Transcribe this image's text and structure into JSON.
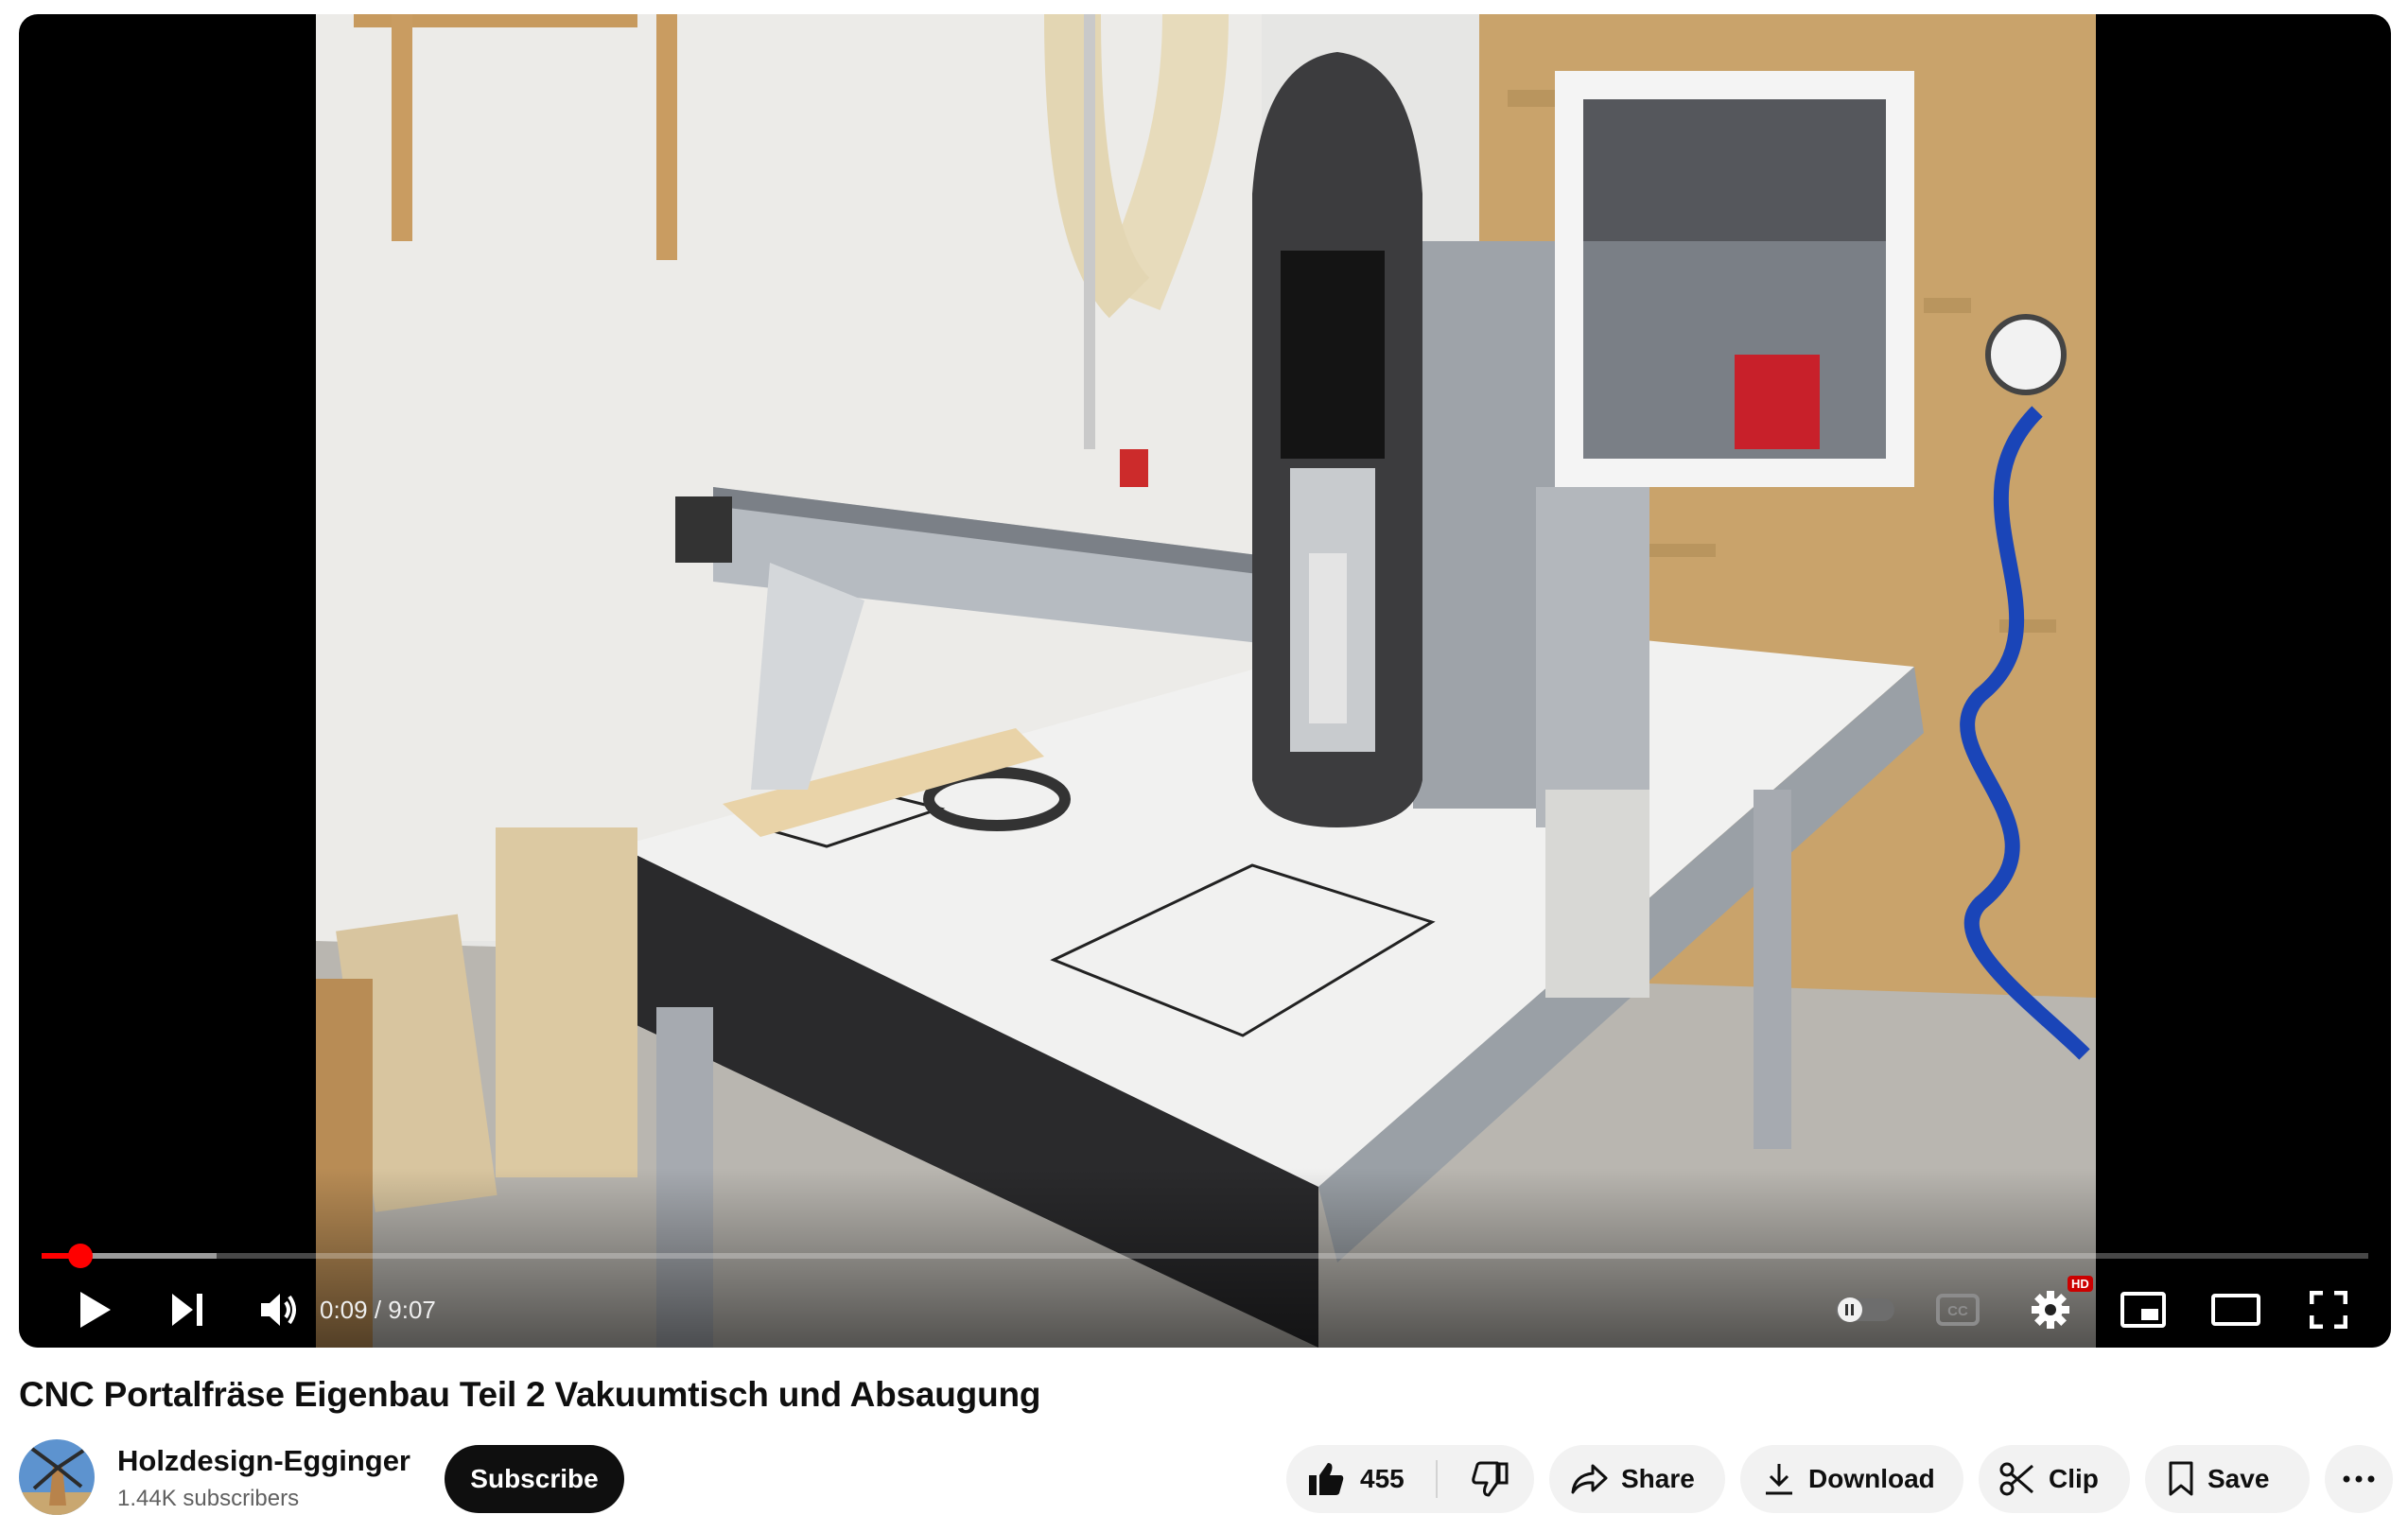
{
  "player": {
    "current_time": "0:09",
    "duration": "9:07",
    "time_display": "0:09 / 9:07",
    "progress_fraction": 0.0165,
    "buffer_fraction": 0.075,
    "hd_badge": "HD",
    "controls": [
      "play-icon",
      "next-icon",
      "volume-icon",
      "autoplay-toggle",
      "captions-icon",
      "settings-icon",
      "miniplayer-icon",
      "theater-icon",
      "fullscreen-icon"
    ],
    "accent_color": "#ff0000"
  },
  "video": {
    "title": "CNC Portalfräse Eigenbau Teil 2 Vakuumtisch und Absaugung"
  },
  "channel": {
    "name": "Holzdesign-Egginger",
    "subscribers": "1.44K subscribers",
    "subscribe_label": "Subscribe"
  },
  "actions": {
    "like_count": "455",
    "share_label": "Share",
    "download_label": "Download",
    "clip_label": "Clip",
    "save_label": "Save"
  }
}
